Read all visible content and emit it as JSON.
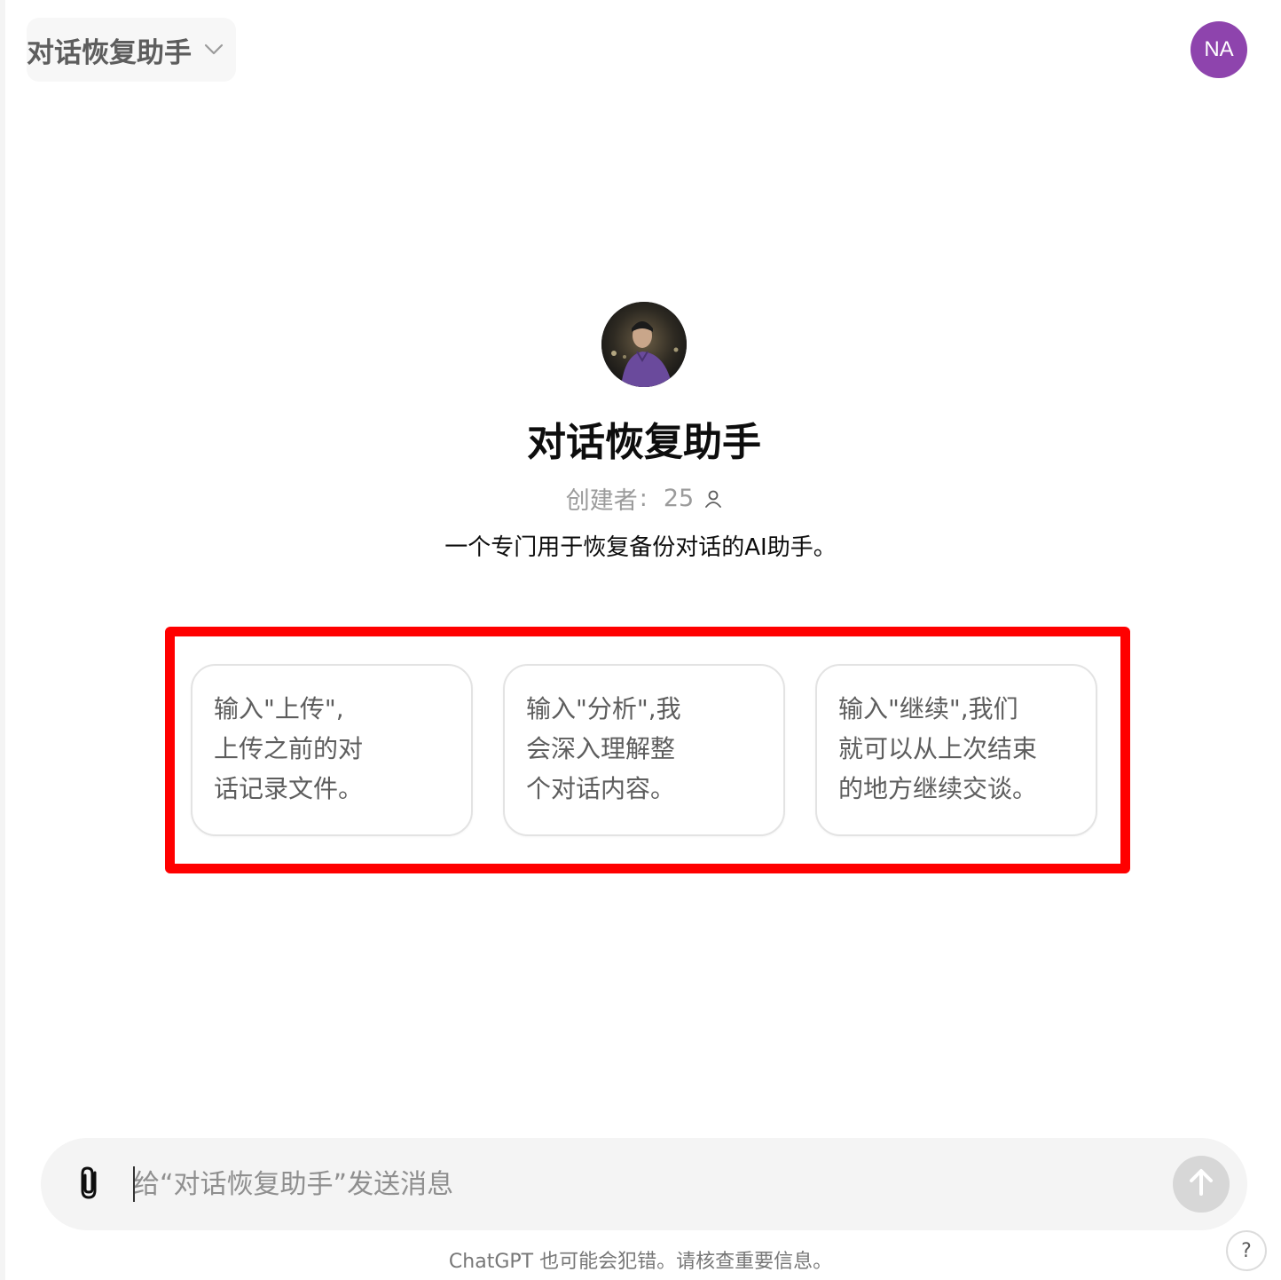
{
  "header": {
    "model_label": "对话恢复助手",
    "user_initials": "NA",
    "user_avatar_color": "#8e44ad"
  },
  "gpt": {
    "title": "对话恢复助手",
    "creator_label": "创建者",
    "creator_separator": ":",
    "creator_count": "25",
    "description": "一个专门用于恢复备份对话的AI助手。"
  },
  "starters": [
    {
      "text": "输入\"上传\",\n上传之前的对\n话记录文件。"
    },
    {
      "text": "输入\"分析\",我\n会深入理解整\n个对话内容。"
    },
    {
      "text": "输入\"继续\",我们\n就可以从上次结束\n的地方继续交谈。"
    }
  ],
  "composer": {
    "placeholder": "给“对话恢复助手”发送消息",
    "value": ""
  },
  "footer": {
    "note": "ChatGPT 也可能会犯错。请核查重要信息。",
    "help_label": "?"
  },
  "colors": {
    "highlight": "#ff0000",
    "send_disabled": "#d7d7d7"
  },
  "icons": {
    "chevron": "chevron-down-icon",
    "person": "person-icon",
    "attach": "paperclip-icon",
    "send": "arrow-up-icon"
  }
}
